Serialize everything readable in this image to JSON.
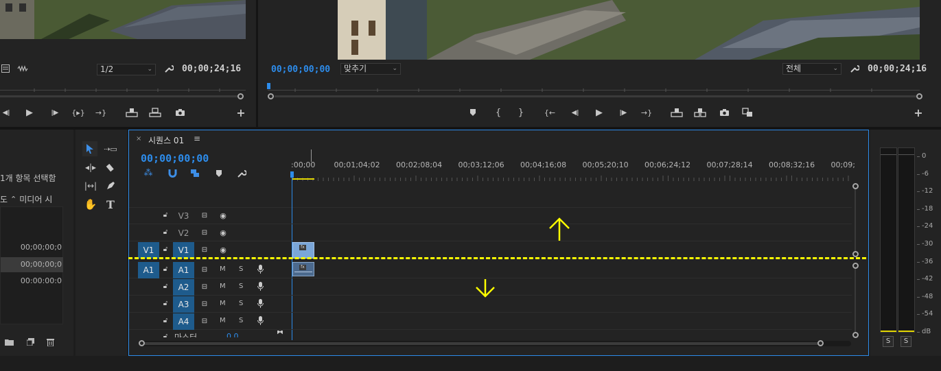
{
  "source_monitor": {
    "zoom_value": "1/2",
    "duration": "00;00;24;16"
  },
  "program_monitor": {
    "current_time": "00;00;00;00",
    "fit_value": "맞추기",
    "quality_value": "전체",
    "duration": "00;00;24;16"
  },
  "project_panel": {
    "selection_status": "1개 항목 선택함",
    "col_header_left": "도",
    "col_header_media": "미디어 시",
    "rows": [
      "00;00;00;0",
      "00;00;00;0",
      "00:00:00:0"
    ]
  },
  "timeline": {
    "sequence_name": "시퀀스 01",
    "current_time": "00;00;00;00",
    "ruler_labels": [
      ":00;00",
      "00;01;04;02",
      "00;02;08;04",
      "00;03;12;06",
      "00;04;16;08",
      "00;05;20;10",
      "00;06;24;12",
      "00;07;28;14",
      "00;08;32;16",
      "00;09;"
    ],
    "video_tracks": [
      {
        "target": "",
        "name": "V3"
      },
      {
        "target": "",
        "name": "V2"
      },
      {
        "target": "V1",
        "name": "V1"
      }
    ],
    "audio_tracks": [
      {
        "target": "A1",
        "name": "A1",
        "m": "M",
        "s": "S"
      },
      {
        "target": "",
        "name": "A2",
        "m": "M",
        "s": "S"
      },
      {
        "target": "",
        "name": "A3",
        "m": "M",
        "s": "S"
      },
      {
        "target": "",
        "name": "A4",
        "m": "M",
        "s": "S"
      }
    ],
    "master_label": "마스터",
    "master_value": "0.0"
  },
  "audio_meter": {
    "scale": [
      "0",
      "-6",
      "-12",
      "-18",
      "-24",
      "-30",
      "-36",
      "-42",
      "-48",
      "-54",
      "dB"
    ],
    "solo_left": "S",
    "solo_right": "S"
  },
  "colors": {
    "accent_blue": "#2d8ceb",
    "track_target": "#1e5b8c",
    "annotation_yellow": "#ffff00"
  }
}
